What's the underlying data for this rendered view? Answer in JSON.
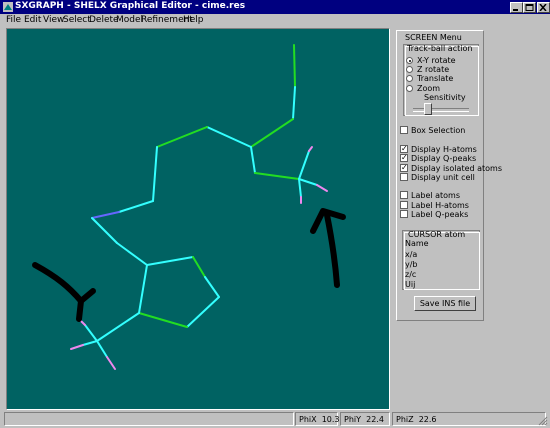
{
  "window": {
    "title": "SXGRAPH - SHELX Graphical Editor - cime.res"
  },
  "menu": [
    "File",
    "Edit",
    "View",
    "Select",
    "Delete",
    "Model",
    "Refinement",
    "Help"
  ],
  "panel": {
    "title": "SCREEN Menu",
    "trackball": {
      "title": "Track-ball action",
      "options": [
        "X-Y rotate",
        "Z rotate",
        "Translate",
        "Zoom"
      ],
      "selected": "X-Y rotate",
      "sensitivity_label": "Sensitivity"
    },
    "checkboxes": [
      {
        "label": "Box Selection",
        "checked": false
      },
      {
        "label": "Display H-atoms",
        "checked": true
      },
      {
        "label": "Display Q-peaks",
        "checked": true
      },
      {
        "label": "Display isolated atoms",
        "checked": true
      },
      {
        "label": "Display unit cell",
        "checked": false
      },
      {
        "label": "Label atoms",
        "checked": false
      },
      {
        "label": "Label H-atoms",
        "checked": false
      },
      {
        "label": "Label Q-peaks",
        "checked": false
      }
    ],
    "cursor": {
      "title": "CURSOR atom",
      "fields": [
        "Name",
        "x/a",
        "y/b",
        "z/c",
        "Uij"
      ]
    },
    "save_button": "Save INS file"
  },
  "status": {
    "phx_label": "PhiX",
    "phx_value": "10.3",
    "phy_label": "PhiY",
    "phy_value": "22.4",
    "phz_label": "PhiZ",
    "phz_value": "22.6"
  },
  "colors": {
    "background": "#006262",
    "bond_carbon": "#33ffff",
    "bond_nitrogen": "#22dd22",
    "bond_fluorine": "#ee88ee",
    "bond_blue": "#6666ff"
  }
}
